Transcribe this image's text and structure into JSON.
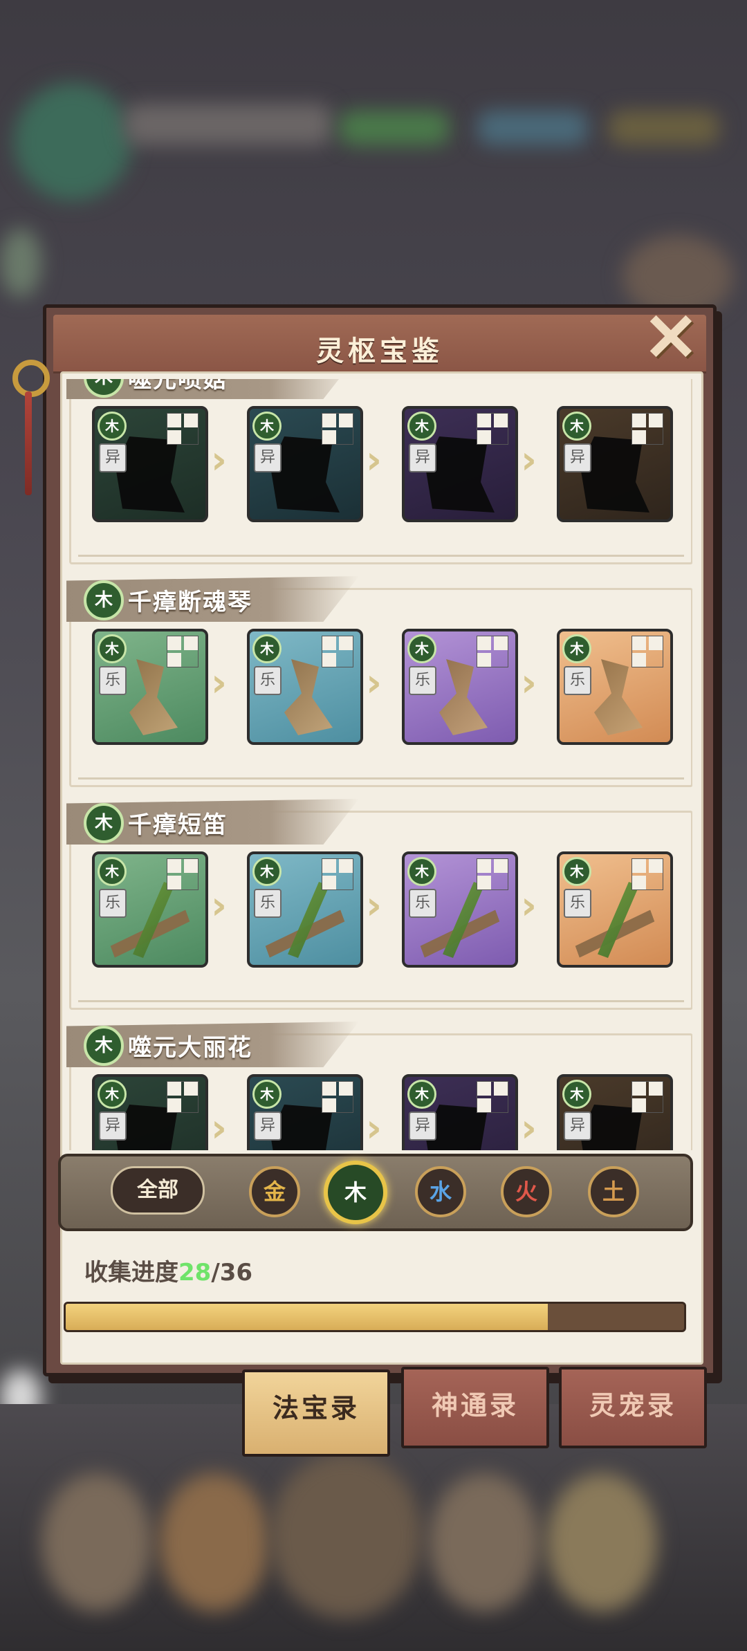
{
  "window": {
    "title": "灵枢宝鉴"
  },
  "colors": {
    "panel": "#6b4a43",
    "wood_element": "#2f5d2f",
    "progress_fill": "#d8ad57",
    "progress_current": "#6fe36a"
  },
  "items": [
    {
      "name": "噬元喷菇",
      "element": "木",
      "tag": "异",
      "locked": true
    },
    {
      "name": "千瘴断魂琴",
      "element": "木",
      "tag": "乐",
      "locked": false
    },
    {
      "name": "千瘴短笛",
      "element": "木",
      "tag": "乐",
      "locked": false
    },
    {
      "name": "噬元大丽花",
      "element": "木",
      "tag": "异",
      "locked": true
    }
  ],
  "filters": {
    "all": "全部",
    "elements": [
      {
        "label": "金",
        "color": "#e3b54a",
        "selected": false
      },
      {
        "label": "木",
        "color": "#ffffff",
        "selected": true
      },
      {
        "label": "水",
        "color": "#5aa4e6",
        "selected": false
      },
      {
        "label": "火",
        "color": "#e0584a",
        "selected": false
      },
      {
        "label": "土",
        "color": "#d59a4e",
        "selected": false
      }
    ]
  },
  "progress": {
    "label": "收集进度",
    "current": "28",
    "sep": "/",
    "total": "36",
    "fraction": 0.78
  },
  "tabs": [
    {
      "label": "法宝录",
      "active": true
    },
    {
      "label": "神通录",
      "active": false
    },
    {
      "label": "灵宠录",
      "active": false
    }
  ]
}
